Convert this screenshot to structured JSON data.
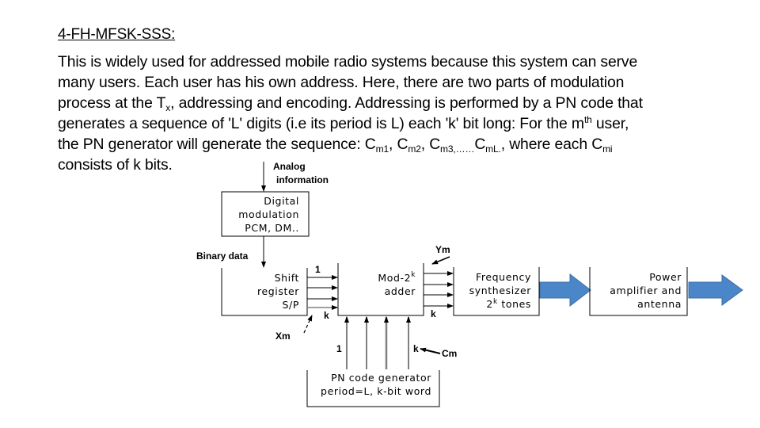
{
  "title": "4-FH-MFSK-SSS:",
  "paragraph": {
    "line1": "This is widely used for addressed mobile radio systems because this system can serve",
    "line2": "many users. Each user has his own  address. Here, there are two parts of modulation",
    "line3_a": "process at the T",
    "line3_sub": "x",
    "line3_b": ", addressing and encoding. Addressing is performed by a PN code that",
    "line4": "generates a sequence of 'L' digits (i.e its period is L) each 'k' bit long: For the m",
    "line4_sup": "th",
    "line4_end": " user,",
    "line5_a": "the PN generator will generate the sequence: C",
    "line5_s1": "m1",
    "line5_b": ", C",
    "line5_s2": "m2",
    "line5_c": ", C",
    "line5_s3": "m3,……",
    "line5_d": "C",
    "line5_s4": "mL.",
    "line5_e": ", where each C",
    "line5_s5": "mi",
    "line6": "consists of k bits."
  },
  "diagram": {
    "analog_label_1": "Analog",
    "analog_label_2": "information",
    "digital_mod": [
      "Digital",
      "modulation",
      "PCM, DM.."
    ],
    "binary_data": "Binary data",
    "shift_register": [
      "Shift",
      "register",
      "S/P"
    ],
    "bit_first": "1",
    "bit_last": "k",
    "xm": "Xm",
    "ym": "Ym",
    "cm": "Cm",
    "adder_line1": "Mod-2",
    "adder_sup": "k",
    "adder_line2": "adder",
    "freq_synth": [
      "Frequency",
      "synthesizer"
    ],
    "freq_tones_base": "2",
    "freq_tones_sup": "k",
    "freq_tones_rest": " tones",
    "power_amp": [
      "Power",
      "amplifier and",
      "antenna"
    ],
    "pn_gen": [
      "PN code generator",
      "period=L, k-bit word"
    ],
    "colors": {
      "arrow_fill": "#4a86c8",
      "arrow_stroke": "#3a6ea5",
      "line": "#000000",
      "gray_line": "#808080"
    }
  }
}
